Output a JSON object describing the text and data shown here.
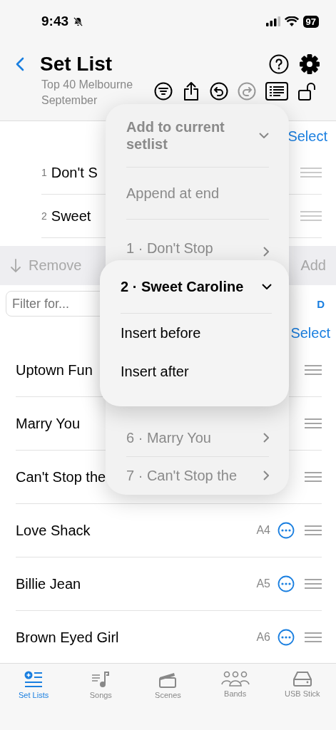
{
  "status_bar": {
    "time": "9:43",
    "battery": "97"
  },
  "header": {
    "title": "Set List",
    "subtitle": "Top 40 Melbourne September"
  },
  "setlist": {
    "select": "Select",
    "rows": [
      {
        "number": "1",
        "title": "Don't S"
      },
      {
        "number": "2",
        "title": "Sweet"
      }
    ]
  },
  "toolbar": {
    "remove": "Remove",
    "add": "Add"
  },
  "filter": {
    "placeholder": "Filter for...",
    "index_letter": "D"
  },
  "songs_select": "Select",
  "songs": [
    {
      "title": "Uptown Fun"
    },
    {
      "title": "Marry You"
    },
    {
      "title": "Can't Stop the"
    },
    {
      "title": "Love Shack",
      "key": "A4"
    },
    {
      "title": "Billie Jean",
      "key": "A5"
    },
    {
      "title": "Brown Eyed Girl",
      "key": "A6"
    }
  ],
  "menu": {
    "title": "Add to current setlist",
    "items": [
      {
        "label": "Append at end",
        "kind": "action"
      },
      {
        "label": "1 · Don't Stop",
        "kind": "submenu"
      },
      {
        "label": "6 · Marry You",
        "kind": "submenu"
      },
      {
        "label": "7 · Can't Stop the",
        "kind": "submenu"
      }
    ]
  },
  "submenu": {
    "title": "2 · Sweet Caroline",
    "items": [
      {
        "label": "Insert before"
      },
      {
        "label": "Insert after"
      }
    ]
  },
  "tabs": [
    {
      "label": "Set Lists",
      "selected": true,
      "kind": "setlists"
    },
    {
      "label": "Songs",
      "selected": false,
      "kind": "songs"
    },
    {
      "label": "Scenes",
      "selected": false,
      "kind": "scenes"
    },
    {
      "label": "Bands",
      "selected": false,
      "kind": "bands"
    },
    {
      "label": "USB Stick",
      "selected": false,
      "kind": "usb"
    }
  ]
}
